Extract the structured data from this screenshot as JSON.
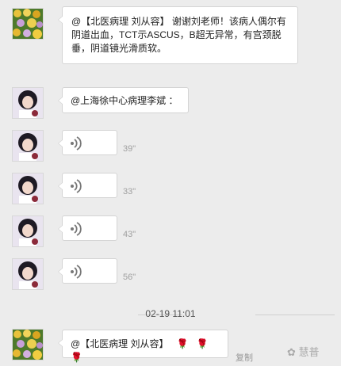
{
  "messages": {
    "first_text": "@【北医病理 刘从容】 谢谢刘老师！该病人偶尔有阴道出血，TCT示ASCUS，B超无异常，有宫颈脱垂，阴道镜光滑质软。",
    "mention_text": "@上海徐中心病理李斌 ：",
    "last_text": "@【北医病理 刘从容】",
    "last_emoji": "🌹🌹🌹"
  },
  "voice_messages": [
    {
      "duration": "39\""
    },
    {
      "duration": "33\""
    },
    {
      "duration": "43\""
    },
    {
      "duration": "56\""
    }
  ],
  "timestamp": "02-19 11:01",
  "actions": {
    "copy_label": "复制"
  },
  "watermark": "✿ 慧普",
  "colors": {
    "background": "#ececec",
    "bubble": "#ffffff",
    "rose": "#c0392b"
  }
}
